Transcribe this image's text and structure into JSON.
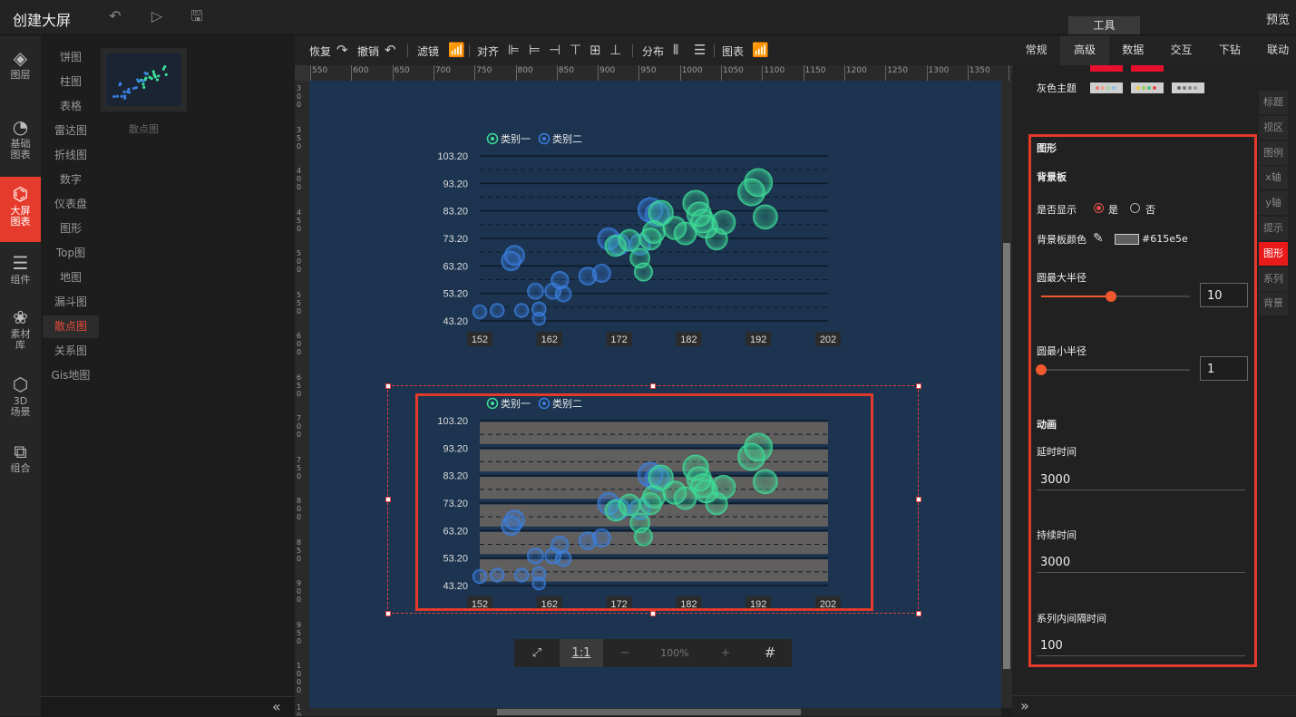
{
  "app": {
    "title": "创建大屏",
    "preview": "预览",
    "tool_tab": "工具"
  },
  "iconbar": [
    {
      "label": "图层",
      "icon": "layers-icon"
    },
    {
      "label": "基础图表",
      "icon": "pie-chart-icon"
    },
    {
      "label": "大屏图表",
      "icon": "screen-chart-icon",
      "active": true
    },
    {
      "label": "组件",
      "icon": "sliders-icon"
    },
    {
      "label": "素材库",
      "icon": "material-icon"
    },
    {
      "label": "3D场景",
      "icon": "cube-icon"
    },
    {
      "label": "组合",
      "icon": "group-icon"
    }
  ],
  "submenu": [
    "饼图",
    "柱图",
    "表格",
    "雷达图",
    "折线图",
    "数字",
    "仪表盘",
    "图形",
    "Top图",
    "地图",
    "漏斗图",
    "散点图",
    "关系图",
    "Gis地图"
  ],
  "submenu_active": "散点图",
  "thumbnail": {
    "label": "散点图"
  },
  "toolbar": {
    "redo": "恢复",
    "undo": "撤销",
    "filter": "滤镜",
    "align": "对齐",
    "distribute": "分布",
    "chart": "图表"
  },
  "ruler_h": [
    "550",
    "600",
    "650",
    "700",
    "750",
    "800",
    "850",
    "900",
    "950",
    "1000",
    "1050",
    "1100",
    "1150",
    "1200",
    "1250",
    "1300",
    "1350",
    "14"
  ],
  "ruler_v": [
    "300",
    "350",
    "400",
    "450",
    "500",
    "550",
    "600",
    "650",
    "700",
    "750",
    "800",
    "850",
    "900",
    "950",
    "1000",
    "1050"
  ],
  "zoom": {
    "fit": "⤢",
    "one_to_one": "1:1",
    "minus": "−",
    "value": "100%",
    "plus": "+",
    "grid": "#"
  },
  "right_tabs": [
    "常规",
    "高级",
    "数据",
    "交互",
    "下钻",
    "联动"
  ],
  "right_tab_active": "高级",
  "side_tabs": [
    "标题",
    "视区",
    "图例",
    "x轴",
    "y轴",
    "提示",
    "图形",
    "系列",
    "背景"
  ],
  "side_tab_active": "图形",
  "themes": {
    "gray_label": "灰色主题",
    "top_colors": [
      "#e8112d",
      "#e8112d"
    ],
    "gray_swatches": [
      {
        "bg": "#cfcfcf",
        "dots": [
          "#e87c6a",
          "#f0a08a",
          "#a8d4a0",
          "#8ac0e8"
        ]
      },
      {
        "bg": "#cfcfcf",
        "dots": [
          "#f3c64a",
          "#9bd14f",
          "#4fc07a",
          "#e84a4a"
        ]
      },
      {
        "bg": "#cfcfcf",
        "dots": [
          "#666",
          "#777",
          "#888",
          "#999"
        ]
      }
    ]
  },
  "form": {
    "section_shape": "图形",
    "section_bg": "背景板",
    "show_label": "是否显示",
    "yes": "是",
    "no": "否",
    "bg_color_label": "背景板颜色",
    "bg_color_value": "#615e5e",
    "max_radius_label": "圆最大半径",
    "max_radius": "10",
    "max_radius_fraction": 0.47,
    "min_radius_label": "圆最小半径",
    "min_radius": "1",
    "min_radius_fraction": 0.0,
    "anim_section": "动画",
    "delay_label": "延时时间",
    "delay": "3000",
    "duration_label": "持续时间",
    "duration": "3000",
    "interval_label": "系列内间隔时间",
    "interval": "100"
  },
  "chart_data": [
    {
      "type": "scatter",
      "legend": [
        "类别一",
        "类别二"
      ],
      "y_ticks": [
        "103.20",
        "93.20",
        "83.20",
        "73.20",
        "63.20",
        "53.20",
        "43.20"
      ],
      "x_ticks": [
        "152",
        "162",
        "172",
        "182",
        "192",
        "202"
      ],
      "xlim": [
        152,
        202
      ],
      "ylim": [
        43.2,
        103.2
      ],
      "background_panel": false,
      "series": [
        {
          "name": "类别一",
          "color": "#3ddc97",
          "points": [
            [
              171.5,
              70.5
            ],
            [
              173.5,
              72.5
            ],
            [
              175,
              66
            ],
            [
              175.5,
              61
            ],
            [
              176.5,
              73
            ],
            [
              177,
              75.5
            ],
            [
              178,
              82.5
            ],
            [
              180,
              77
            ],
            [
              181.5,
              75
            ],
            [
              183,
              86
            ],
            [
              183.5,
              82
            ],
            [
              184,
              79.5
            ],
            [
              184.5,
              77.5
            ],
            [
              186,
              73
            ],
            [
              187,
              79
            ],
            [
              191,
              90
            ],
            [
              192,
              93.5
            ],
            [
              193,
              81
            ]
          ]
        },
        {
          "name": "类别二",
          "color": "#3a7fe0",
          "points": [
            [
              152,
              46.5
            ],
            [
              154.5,
              47
            ],
            [
              156.5,
              65
            ],
            [
              157,
              67
            ],
            [
              158,
              47
            ],
            [
              160,
              54
            ],
            [
              160.5,
              47.5
            ],
            [
              160.5,
              44
            ],
            [
              162.5,
              54
            ],
            [
              163.5,
              58
            ],
            [
              164,
              53
            ],
            [
              167.5,
              59.5
            ],
            [
              169.5,
              60.5
            ],
            [
              170.5,
              73
            ],
            [
              172,
              71
            ],
            [
              175,
              71
            ],
            [
              176.5,
              83.5
            ],
            [
              177.5,
              82
            ]
          ]
        }
      ]
    },
    {
      "type": "scatter",
      "legend": [
        "类别一",
        "类别二"
      ],
      "y_ticks": [
        "103.20",
        "93.20",
        "83.20",
        "73.20",
        "63.20",
        "53.20",
        "43.20"
      ],
      "x_ticks": [
        "152",
        "162",
        "172",
        "182",
        "192",
        "202"
      ],
      "xlim": [
        152,
        202
      ],
      "ylim": [
        43.2,
        103.2
      ],
      "background_panel": true,
      "panel_color": "#615e5e",
      "series": [
        {
          "name": "类别一",
          "color": "#3ddc97",
          "points": [
            [
              171.5,
              70.5
            ],
            [
              173.5,
              72.5
            ],
            [
              175,
              66
            ],
            [
              175.5,
              61
            ],
            [
              176.5,
              73
            ],
            [
              177,
              75.5
            ],
            [
              178,
              82.5
            ],
            [
              180,
              77
            ],
            [
              181.5,
              75
            ],
            [
              183,
              86
            ],
            [
              183.5,
              82
            ],
            [
              184,
              79.5
            ],
            [
              184.5,
              77.5
            ],
            [
              186,
              73
            ],
            [
              187,
              79
            ],
            [
              191,
              90
            ],
            [
              192,
              93.5
            ],
            [
              193,
              81
            ]
          ]
        },
        {
          "name": "类别二",
          "color": "#3a7fe0",
          "points": [
            [
              152,
              46.5
            ],
            [
              154.5,
              47
            ],
            [
              156.5,
              65
            ],
            [
              157,
              67
            ],
            [
              158,
              47
            ],
            [
              160,
              54
            ],
            [
              160.5,
              47.5
            ],
            [
              160.5,
              44
            ],
            [
              162.5,
              54
            ],
            [
              163.5,
              58
            ],
            [
              164,
              53
            ],
            [
              167.5,
              59.5
            ],
            [
              169.5,
              60.5
            ],
            [
              170.5,
              73
            ],
            [
              172,
              71
            ],
            [
              175,
              71
            ],
            [
              176.5,
              83.5
            ],
            [
              177.5,
              82
            ]
          ]
        }
      ]
    }
  ]
}
